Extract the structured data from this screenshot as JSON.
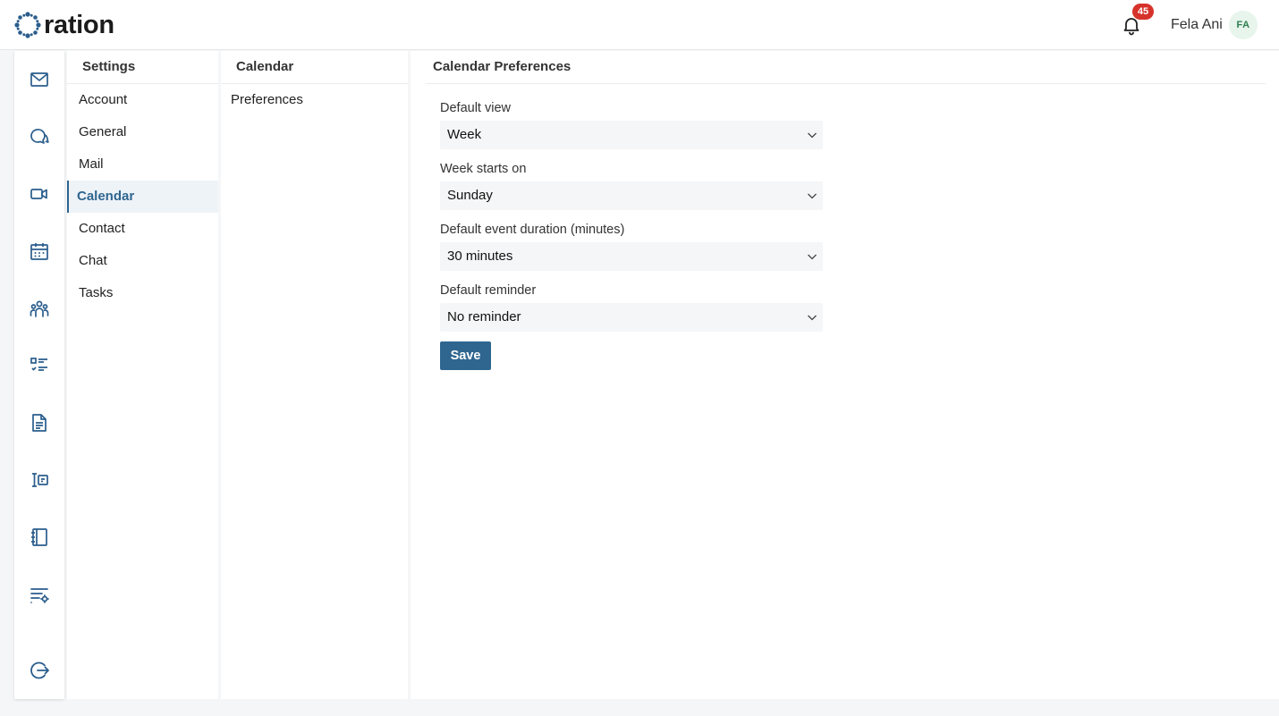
{
  "app": {
    "logo_text": "ration",
    "notification_count": "45",
    "user_name": "Fela Ani",
    "user_initials": "FA"
  },
  "rail": {
    "icons": [
      "mail-icon",
      "chat-icon",
      "video-icon",
      "calendar-icon",
      "contacts-icon",
      "tasks-icon",
      "document-icon",
      "announcement-icon",
      "notebook-icon",
      "settings-list-icon",
      "logout-icon"
    ]
  },
  "settings": {
    "title": "Settings",
    "items": [
      "Account",
      "General",
      "Mail",
      "Calendar",
      "Contact",
      "Chat",
      "Tasks"
    ],
    "active": "Calendar"
  },
  "calendar_menu": {
    "title": "Calendar",
    "items": [
      "Preferences"
    ]
  },
  "preferences": {
    "title": "Calendar Preferences",
    "default_view": {
      "label": "Default view",
      "value": "Week"
    },
    "week_start": {
      "label": "Week starts on",
      "value": "Sunday"
    },
    "event_duration": {
      "label": "Default event duration (minutes)",
      "value": "30 minutes"
    },
    "reminder": {
      "label": "Default reminder",
      "value": "No reminder"
    },
    "save_label": "Save"
  },
  "colors": {
    "accent": "#2f6690",
    "badge": "#d6322b",
    "avatar_bg": "#e7f5ec",
    "avatar_text": "#2e7d4f"
  }
}
